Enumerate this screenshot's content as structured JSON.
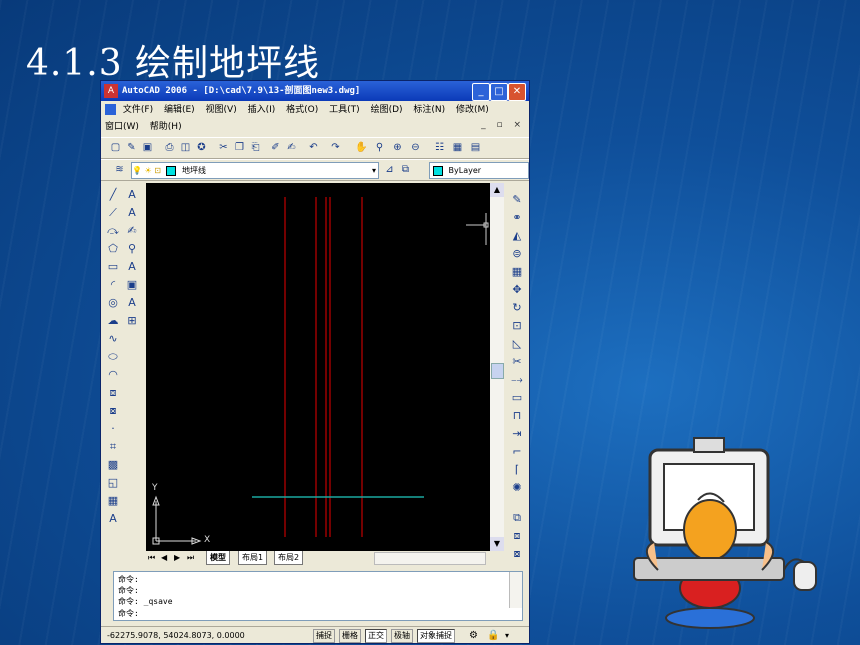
{
  "slide": {
    "title": "4.1.3 绘制地坪线"
  },
  "window": {
    "title": "AutoCAD 2006 - [D:\\cad\\7.9\\13-剖面图new3.dwg]",
    "controls": {
      "minimize": "_",
      "maximize": "□",
      "close": "✕"
    }
  },
  "menu": {
    "row1": [
      "文件(F)",
      "编辑(E)",
      "视图(V)",
      "插入(I)",
      "格式(O)",
      "工具(T)",
      "绘图(D)",
      "标注(N)",
      "修改(M)"
    ],
    "row2": [
      "窗口(W)",
      "帮助(H)"
    ],
    "doc_controls": "_ ▫ ×"
  },
  "layer_toolbar": {
    "layer_name": "地坪线",
    "color_value": "ByLayer"
  },
  "canvas": {
    "ucs_y": "Y",
    "ucs_x": "X"
  },
  "layout_tabs": {
    "model": "模型",
    "layout1": "布局1",
    "layout2": "布局2"
  },
  "command": {
    "lines": [
      "命令:",
      "命令:",
      "命令:  _qsave",
      "命令:"
    ]
  },
  "status": {
    "coords": "-62275.9078,  54024.8073,  0.0000",
    "buttons": [
      "捕捉",
      "栅格",
      "正交",
      "极轴",
      "对象捕捉"
    ]
  },
  "colors": {
    "line_red": "#c00000",
    "line_cyan": "#1aa7a0",
    "titlebar": "#0b3ab8",
    "slide_bg": "#0f4f9a"
  }
}
